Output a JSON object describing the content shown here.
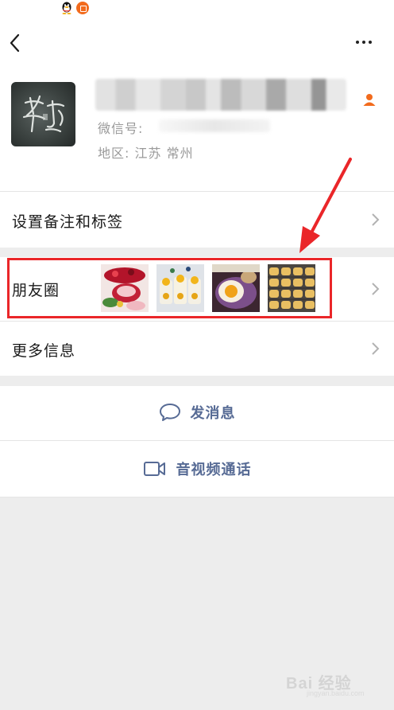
{
  "profile": {
    "id_label": "微信号:",
    "region": "地区:  江苏  常州"
  },
  "rows": {
    "remark": "设置备注和标签",
    "moments": "朋友圈",
    "more_info": "更多信息"
  },
  "actions": {
    "send_message": "发消息",
    "video_call": "音视频通话"
  },
  "watermark": {
    "text": "Bai 经验",
    "sub": "jingyan.baidu.com"
  },
  "colors": {
    "link_blue": "#576b95",
    "highlight_red": "#ea2629",
    "accent_orange": "#f26b1d"
  }
}
